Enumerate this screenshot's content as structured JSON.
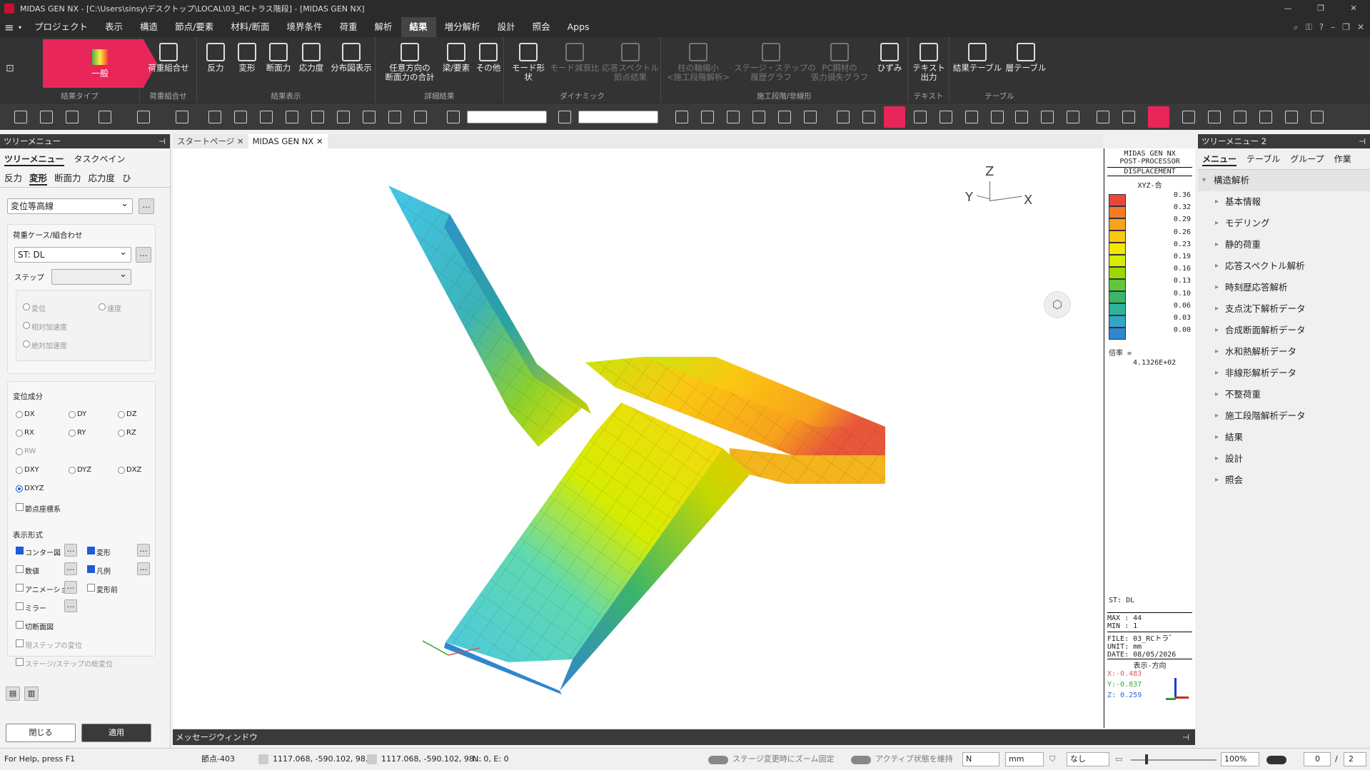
{
  "window": {
    "title": "MIDAS GEN NX - [C:\\Users\\sinsy\\デスクトップ\\LOCAL\\03_RCトラス階段] - [MIDAS GEN NX]"
  },
  "menu": {
    "items": [
      "プロジェクト",
      "表示",
      "構造",
      "節点/要素",
      "材料/断面",
      "境界条件",
      "荷重",
      "解析",
      "結果",
      "増分解析",
      "設計",
      "照会",
      "Apps"
    ],
    "active": "結果"
  },
  "ribbon": {
    "result_type": "一般",
    "group_labels": {
      "type": "結果タイプ",
      "combo": "荷重組合せ",
      "display": "結果表示",
      "detail": "詳細結果",
      "dynamic": "ダイナミック",
      "stage": "施工段階/非線形",
      "text": "テキスト",
      "table": "テーブル"
    },
    "combo_btn": "荷重組合せ",
    "display_btns": [
      "反力",
      "変形",
      "断面力",
      "応力度",
      "分布図表示"
    ],
    "detail_btns": [
      "任意方向の\n断面力の合計",
      "梁/要素",
      "その他"
    ],
    "dynamic_btns": [
      "モード形状",
      "モード減衰比",
      "応答スペクトル\n節点結果"
    ],
    "stage_btns": [
      "柱の軸縮小\n<施工段階解析>",
      "ステージ・ステップの\n履歴グラフ",
      "PC鋼材の\n張力損失グラフ",
      "ひずみ"
    ],
    "text_btn": "テキスト\n出力",
    "table_btns": [
      "結果テーブル",
      "層テーブル"
    ]
  },
  "left_panel": {
    "header": "ツリーメニュー",
    "tabs": [
      "ツリーメニュー",
      "タスクペイン"
    ],
    "subtabs": [
      "反力",
      "変形",
      "断面力",
      "応力度",
      "ひ"
    ],
    "mode_select": "変位等高線",
    "loadcase_label": "荷重ケース/組合わせ",
    "loadcase_value": "ST: DL",
    "step_label": "ステップ",
    "radios_dyn": [
      "変位",
      "速度",
      "相対加速度",
      "絶対加速度"
    ],
    "component_label": "変位成分",
    "components": [
      "DX",
      "DY",
      "DZ",
      "RX",
      "RY",
      "RZ",
      "RW",
      "DXY",
      "DYZ",
      "DXZ",
      "DXYZ"
    ],
    "component_selected": "DXYZ",
    "node_coord": "節点座標系",
    "display_label": "表示形式",
    "display_opts": [
      "コンター図",
      "変形",
      "数値",
      "凡例",
      "アニメーション",
      "変形前",
      "ミラー",
      "切断面図",
      "現ステップの変位",
      "ステージ/ステップの総変位"
    ],
    "close_btn": "閉じる",
    "apply_btn": "適用"
  },
  "doc_tabs": [
    "スタートページ",
    "MIDAS GEN NX"
  ],
  "axis": {
    "z": "Z",
    "y": "Y",
    "x": "X"
  },
  "legend": {
    "title1": "MIDAS GEN NX",
    "title2": "POST-PROCESSOR",
    "title3": "DISPLACEMENT",
    "comp": "XYZ-合",
    "values": [
      "0.36",
      "0.32",
      "0.29",
      "0.26",
      "0.23",
      "0.19",
      "0.16",
      "0.13",
      "0.10",
      "0.06",
      "0.03",
      "0.00"
    ],
    "colors": [
      "#e8473a",
      "#f37a2a",
      "#f8a21c",
      "#fbc712",
      "#f4e600",
      "#d6ec00",
      "#9ed800",
      "#5fc83a",
      "#3bb56a",
      "#2fb39e",
      "#33a6c8",
      "#2f86cf"
    ],
    "scale_label": "倍率 =",
    "scale_value": "4.1326E+02",
    "case": "ST: DL",
    "max": "MAX : 44",
    "min": "MIN : 1",
    "file": "FILE: 03_RCトラ゛",
    "unit": "UNIT: mm",
    "date": "DATE: 08/05/2026",
    "view_dir": "表示-方向",
    "vx": "X:-0.483",
    "vy": "Y:-0.837",
    "vz": "Z: 0.259"
  },
  "message_window": "メッセージウィンドウ",
  "right_panel": {
    "header": "ツリーメニュー 2",
    "tabs": [
      "メニュー",
      "テーブル",
      "グループ",
      "作業"
    ],
    "root": "構造解析",
    "items": [
      "基本情報",
      "モデリング",
      "静的荷重",
      "応答スペクトル解析",
      "時刻歴応答解析",
      "支点沈下解析データ",
      "合成断面解析データ",
      "水和熱解析データ",
      "非線形解析データ",
      "不整荷重",
      "施工段階解析データ",
      "結果",
      "設計",
      "照会"
    ]
  },
  "status": {
    "help": "For Help, press F1",
    "node": "節点-403",
    "coord1": "1117.068, -590.102, 98...",
    "coord2": "1117.068, -590.102, 98...",
    "ne": "N: 0, E: 0",
    "zoom_fix": "ステージ変更時にズーム固定",
    "keep_active": "アクティブ状態を維持",
    "force_unit": "N",
    "len_unit": "mm",
    "filter": "なし",
    "zoom": "100%",
    "page": "0",
    "total": "2"
  }
}
